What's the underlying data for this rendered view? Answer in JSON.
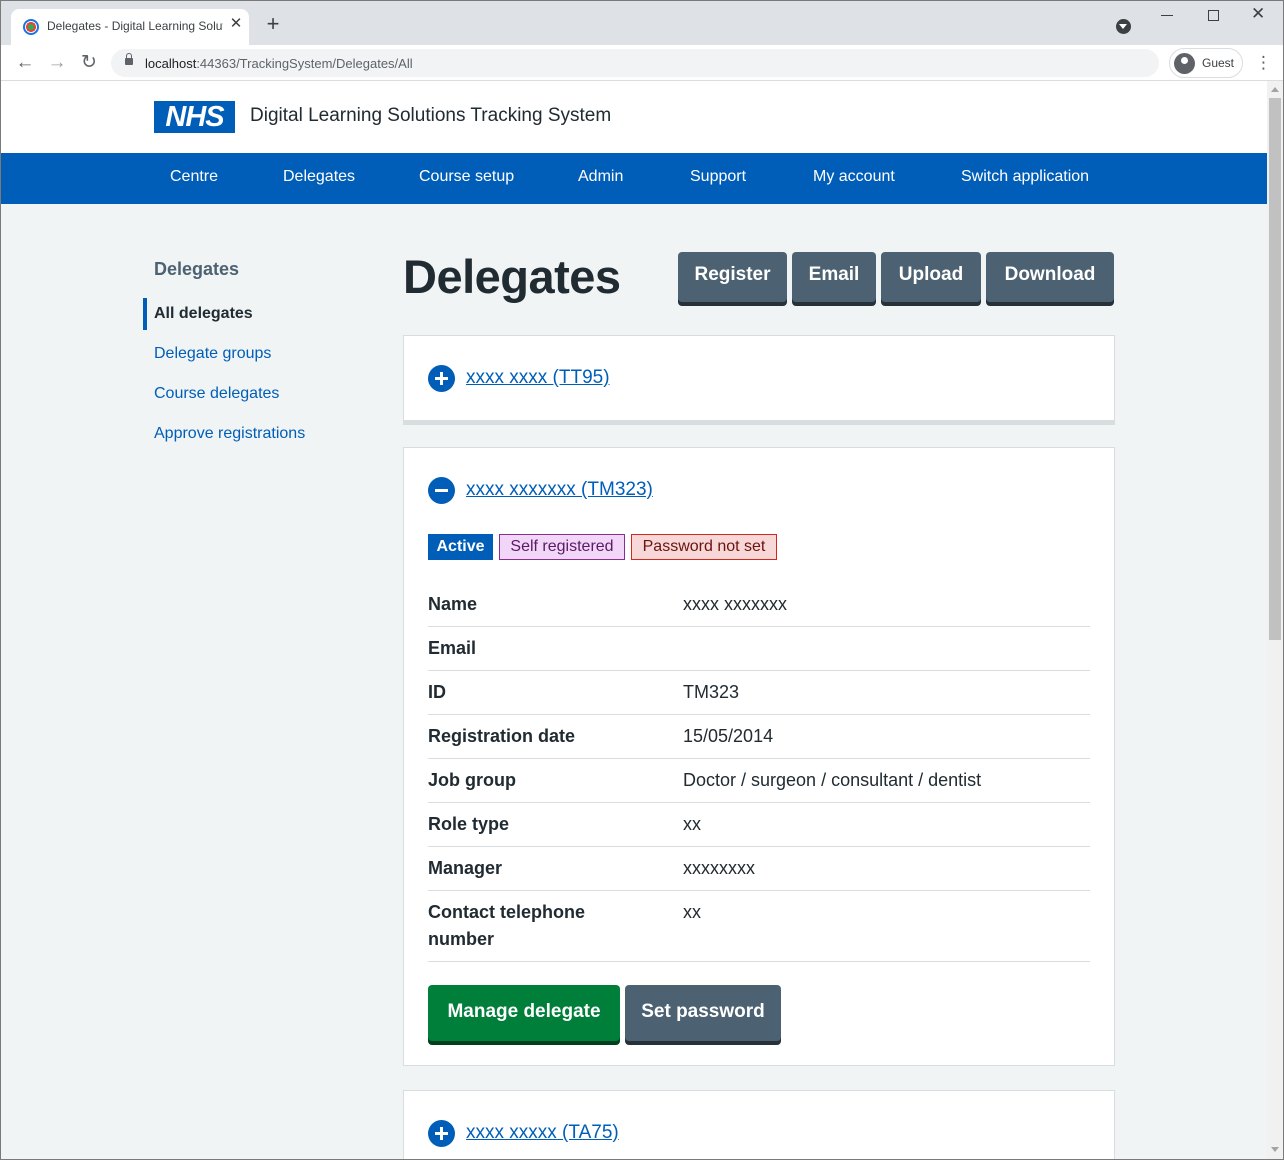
{
  "browser": {
    "tab_title": "Delegates - Digital Learning Solutions",
    "new_tab_label": "+",
    "url_host": "localhost",
    "url_rest": ":44363/TrackingSystem/Delegates/All",
    "profile_label": "Guest"
  },
  "header": {
    "logo_text": "NHS",
    "service_name": "Digital Learning Solutions Tracking System"
  },
  "nav": {
    "items": [
      "Centre",
      "Delegates",
      "Course setup",
      "Admin",
      "Support",
      "My account",
      "Switch application"
    ]
  },
  "sidebar": {
    "title": "Delegates",
    "items": [
      {
        "label": "All delegates",
        "current": true
      },
      {
        "label": "Delegate groups",
        "current": false
      },
      {
        "label": "Course delegates",
        "current": false
      },
      {
        "label": "Approve registrations",
        "current": false
      }
    ]
  },
  "page": {
    "title": "Delegates",
    "actions": [
      "Register",
      "Email",
      "Upload",
      "Download"
    ]
  },
  "delegates": [
    {
      "label": "xxxx xxxx (TT95)",
      "expanded": false
    },
    {
      "label": "xxxx xxxxxxx (TM323)",
      "expanded": true,
      "tags": [
        "Active",
        "Self registered",
        "Password not set"
      ],
      "details": [
        {
          "label": "Name",
          "value": "xxxx xxxxxxx"
        },
        {
          "label": "Email",
          "value": ""
        },
        {
          "label": "ID",
          "value": "TM323"
        },
        {
          "label": "Registration date",
          "value": "15/05/2014"
        },
        {
          "label": "Job group",
          "value": "Doctor / surgeon / consultant / dentist"
        },
        {
          "label": "Role type",
          "value": "xx"
        },
        {
          "label": "Manager",
          "value": "xxxxxxxx"
        },
        {
          "label": "Contact telephone number",
          "value": "xx"
        }
      ],
      "buttons": {
        "manage": "Manage delegate",
        "set_password": "Set password"
      }
    },
    {
      "label": "xxxx xxxxx (TA75)",
      "expanded": false
    }
  ],
  "colors": {
    "nhs_blue": "#005eb8",
    "page_bg": "#f0f4f5",
    "secondary_button": "#4c6272",
    "primary_button": "#007f3b"
  }
}
